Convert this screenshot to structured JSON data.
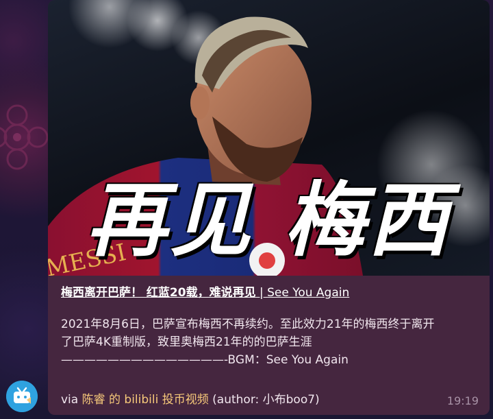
{
  "message": {
    "preview_overlay_text": "再见 梅西",
    "jersey_text": "MESSI",
    "link_title_bold": "梅西离开巴萨！ 红蓝20载，难说再见",
    "link_title_rest": " | See You Again",
    "description_lines": [
      "2021年8月6日，巴萨宣布梅西不再续约。至此效力21年的梅西终于离开",
      "了巴萨4K重制版，致里奥梅西21年的的巴萨生涯",
      "——————————————-BGM：See You Again"
    ],
    "via_prefix": "via ",
    "via_channel": "陈睿 的 bilibili 投币视频",
    "via_author": " (author: 小布boo7)",
    "time": "19:19"
  },
  "avatar": {
    "icon": "bilibili-tv-icon",
    "color": "#2fa2e0"
  },
  "colors": {
    "bubble": "#45263f",
    "accent_text": "#f7c97a",
    "timestamp": "#a892a6"
  }
}
